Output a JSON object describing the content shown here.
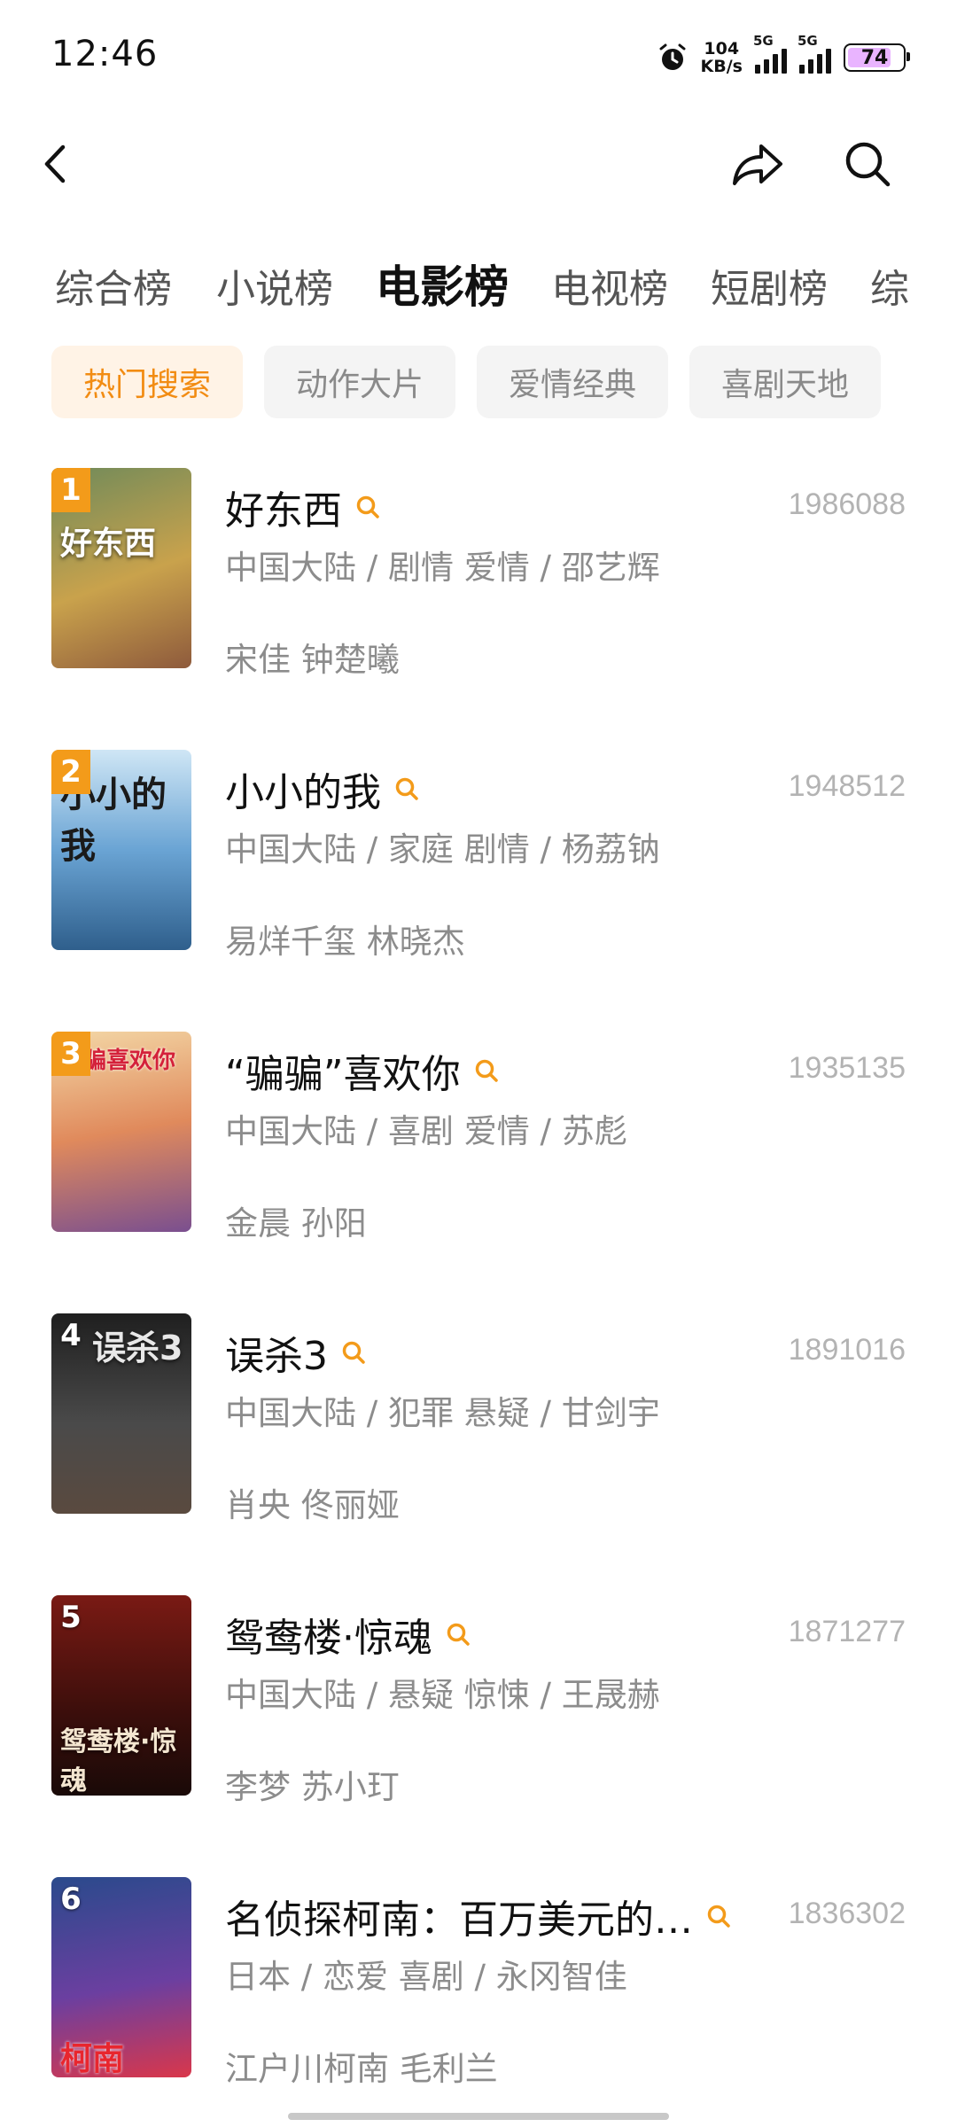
{
  "status": {
    "time": "12:46",
    "net_speed_top": "104",
    "net_speed_bottom": "KB/s",
    "sim1": "5G",
    "sim2": "5G",
    "battery": "74"
  },
  "tabs": [
    "综合榜",
    "小说榜",
    "电影榜",
    "电视榜",
    "短剧榜",
    "综"
  ],
  "chips": [
    "热门搜索",
    "动作大片",
    "爱情经典",
    "喜剧天地"
  ],
  "items": [
    {
      "rank": "1",
      "title": "好东西",
      "hot": "1986088",
      "meta": "中国大陆 / 剧情 爱情 / 邵艺辉",
      "cast": "宋佳 钟楚曦",
      "poster_text": "好东西",
      "poster_colors": [
        "#6f8a5a",
        "#c9a24c",
        "#8e5a3c"
      ]
    },
    {
      "rank": "2",
      "title": "小小的我",
      "hot": "1948512",
      "meta": "中国大陆 / 家庭 剧情 / 杨荔钠",
      "cast": "易烊千玺 林晓杰",
      "poster_text": "小小的我",
      "poster_colors": [
        "#8fc4e6",
        "#4e8fc2",
        "#2f5f8c"
      ]
    },
    {
      "rank": "3",
      "title": "“骗骗”喜欢你",
      "hot": "1935135",
      "meta": "中国大陆 / 喜剧 爱情 / 苏彪",
      "cast": "金晨 孙阳",
      "poster_text": "骗骗喜欢你",
      "poster_colors": [
        "#f3d7a6",
        "#d56a4a",
        "#7a4f8f"
      ]
    },
    {
      "rank": "4",
      "title": "误杀3",
      "hot": "1891016",
      "meta": "中国大陆 / 犯罪 悬疑 / 甘剑宇",
      "cast": "肖央 佟丽娅",
      "poster_text": "误杀3",
      "poster_colors": [
        "#3a3a3a",
        "#1f1f1f",
        "#5a4a3f"
      ]
    },
    {
      "rank": "5",
      "title": "鸳鸯楼·惊魂",
      "hot": "1871277",
      "meta": "中国大陆 / 悬疑 惊悚 / 王晟赫",
      "cast": "李梦 苏小玎",
      "poster_text": "鸳鸯楼·惊魂",
      "poster_colors": [
        "#7a1a14",
        "#3a0e0b",
        "#1a0a08"
      ]
    },
    {
      "rank": "6",
      "title": "名侦探柯南：百万美元的…",
      "hot": "1836302",
      "meta": "日本 / 恋爱 喜剧 / 永冈智佳",
      "cast": "江户川柯南 毛利兰",
      "poster_text": "柯南",
      "poster_colors": [
        "#2a4a8c",
        "#6b3fa0",
        "#d9374b"
      ]
    }
  ],
  "colors": {
    "accent": "#f39b1a",
    "chip_active_bg": "#fff3e6",
    "chip_active_text": "#f28c13",
    "muted_text": "#8c8c8c"
  },
  "icons": {
    "back": "back-arrow-icon",
    "share": "share-icon",
    "search": "search-icon",
    "alarm": "alarm-icon",
    "item_search": "search-small-icon"
  }
}
